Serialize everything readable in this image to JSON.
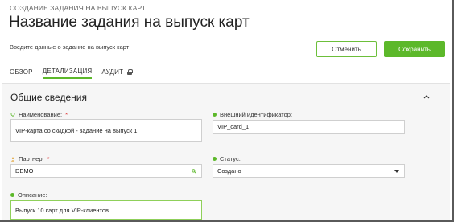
{
  "header": {
    "breadcrumb": "СОЗДАНИЕ ЗАДАНИЯ НА ВЫПУСК КАРТ",
    "title": "Название задания на выпуск карт",
    "subtitle": "Введите данные о задание на выпуск карт"
  },
  "actions": {
    "cancel_label": "Отменить",
    "save_label": "Сохранить"
  },
  "tabs": [
    {
      "label": "ОБЗОР",
      "active": false
    },
    {
      "label": "ДЕТАЛИЗАЦИЯ",
      "active": true
    },
    {
      "label": "АУДИТ",
      "active": false,
      "icon": "lock-icon"
    }
  ],
  "section": {
    "title": "Общие сведения"
  },
  "fields": {
    "name": {
      "label": "Наименование:",
      "required_mark": "*",
      "value": "VIP-карта со скидкой - задание на выпуск 1",
      "icon": "trophy-icon"
    },
    "external_id": {
      "label": "Внешний идентификатор:",
      "value": "VIP_card_1"
    },
    "partner": {
      "label": "Партнер:",
      "required_mark": "*",
      "value": "DEMO",
      "icon": "partner-icon"
    },
    "status": {
      "label": "Статус:",
      "value": "Создано"
    },
    "description": {
      "label": "Описание:",
      "value": "Выпуск 10 карт для VIP-клиентов"
    }
  },
  "colors": {
    "accent": "#5cb82a",
    "required": "#d33333"
  }
}
